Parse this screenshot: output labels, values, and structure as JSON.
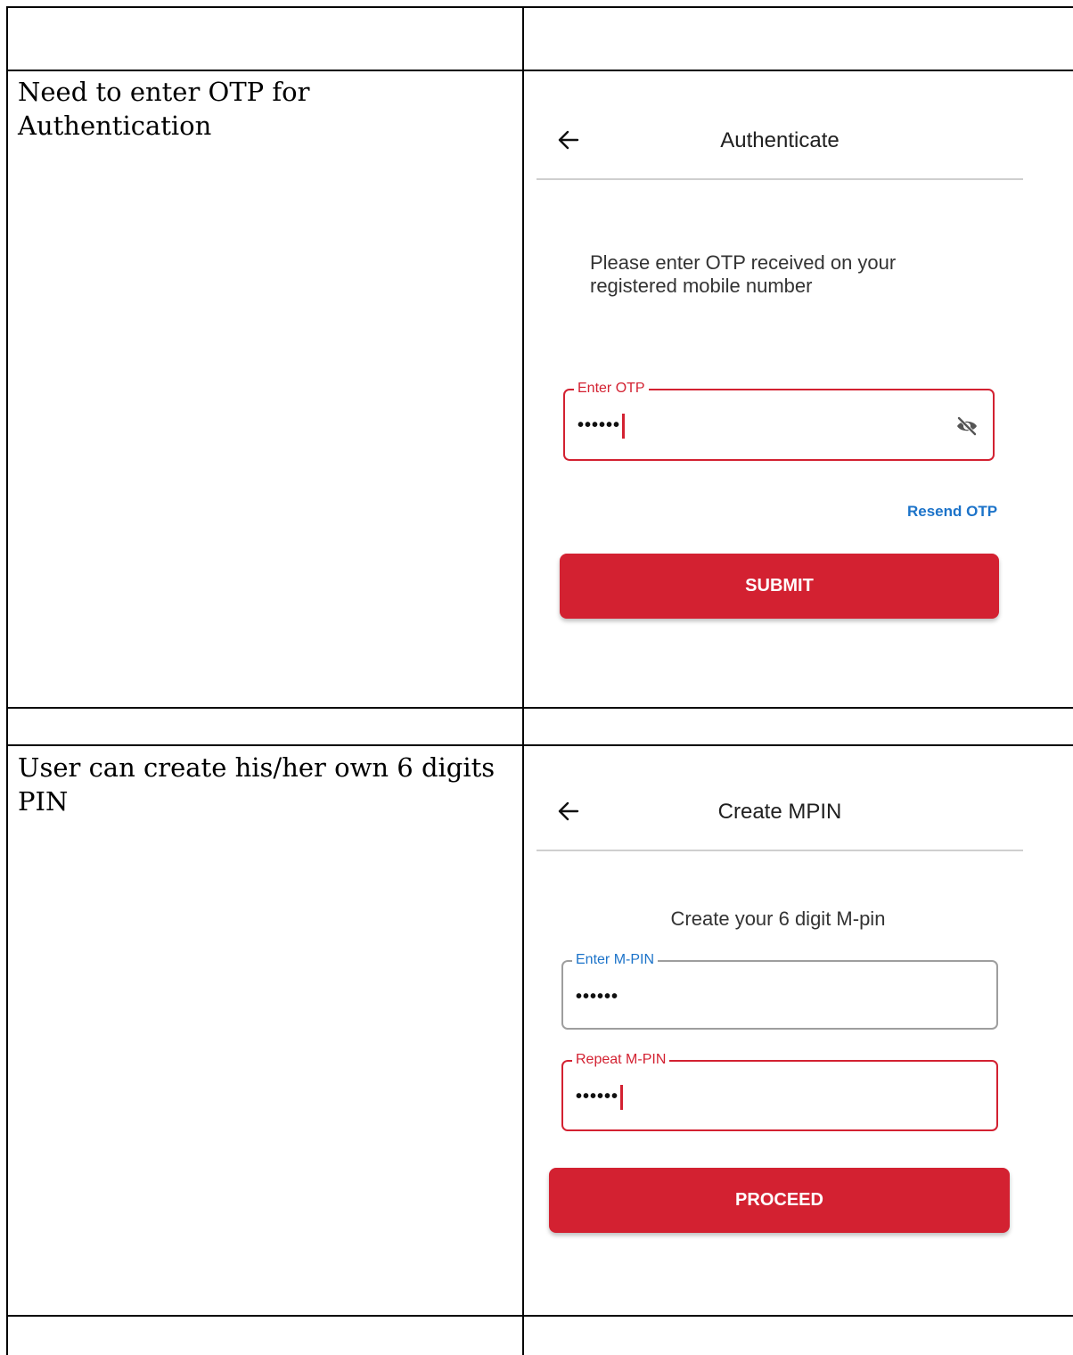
{
  "rows": [
    {
      "description": "Need to enter OTP for Authentication",
      "screen": {
        "title": "Authenticate",
        "message": "Please enter OTP received on your registered mobile number",
        "otp_field": {
          "label": "Enter OTP",
          "value": "••••••"
        },
        "resend_label": "Resend OTP",
        "submit_label": "SUBMIT"
      }
    },
    {
      "description": "User can create his/her own 6 digits PIN",
      "screen": {
        "title": "Create MPIN",
        "message": "Create your 6 digit M-pin",
        "mpin_field": {
          "label": "Enter M-PIN",
          "value": "••••••"
        },
        "repeat_field": {
          "label": "Repeat M-PIN",
          "value": "••••••"
        },
        "proceed_label": "PROCEED"
      }
    }
  ],
  "colors": {
    "primary_red": "#d32131",
    "link_blue": "#1c73c9",
    "border_grey": "#9e9e9e"
  },
  "icons": [
    "arrow-left-icon",
    "eye-off-icon"
  ]
}
